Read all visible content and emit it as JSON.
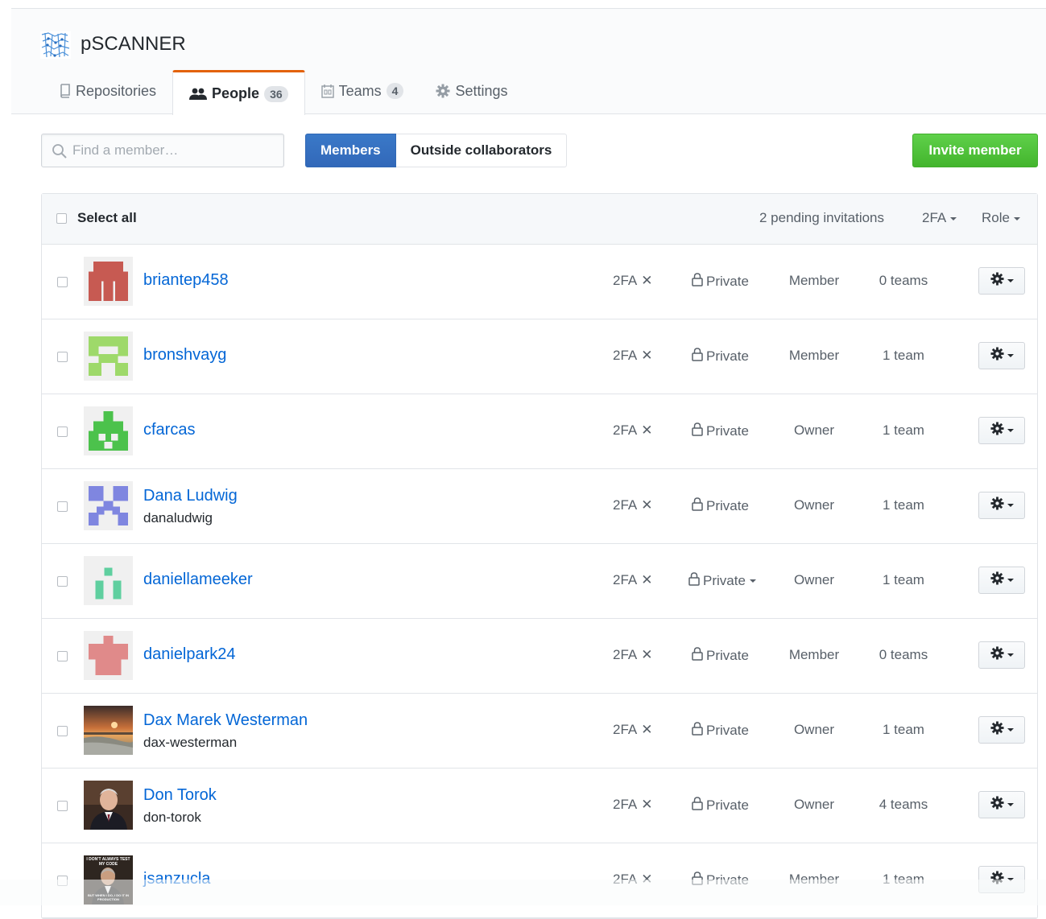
{
  "org": {
    "name": "pSCANNER"
  },
  "tabs": [
    {
      "label": "Repositories",
      "count": ""
    },
    {
      "label": "People",
      "count": "36"
    },
    {
      "label": "Teams",
      "count": "4"
    },
    {
      "label": "Settings",
      "count": ""
    }
  ],
  "search": {
    "placeholder": "Find a member…",
    "value": ""
  },
  "filter_toggle": {
    "members": "Members",
    "outside": "Outside collaborators"
  },
  "invite_label": "Invite member",
  "table_header": {
    "select_all": "Select all",
    "pending": "2 pending invitations",
    "tfa_filter": "2FA",
    "role_filter": "Role"
  },
  "members": [
    {
      "name": "briantep458",
      "login": "",
      "tfa": "2FA",
      "visibility": "Private",
      "role": "Member",
      "teams": "0 teams"
    },
    {
      "name": "bronshvayg",
      "login": "",
      "tfa": "2FA",
      "visibility": "Private",
      "role": "Member",
      "teams": "1 team"
    },
    {
      "name": "cfarcas",
      "login": "",
      "tfa": "2FA",
      "visibility": "Private",
      "role": "Owner",
      "teams": "1 team"
    },
    {
      "name": "Dana Ludwig",
      "login": "danaludwig",
      "tfa": "2FA",
      "visibility": "Private",
      "role": "Owner",
      "teams": "1 team"
    },
    {
      "name": "daniellameeker",
      "login": "",
      "tfa": "2FA",
      "visibility": "Private",
      "role": "Owner",
      "teams": "1 team"
    },
    {
      "name": "danielpark24",
      "login": "",
      "tfa": "2FA",
      "visibility": "Private",
      "role": "Member",
      "teams": "0 teams"
    },
    {
      "name": "Dax Marek Westerman",
      "login": "dax-westerman",
      "tfa": "2FA",
      "visibility": "Private",
      "role": "Owner",
      "teams": "1 team"
    },
    {
      "name": "Don Torok",
      "login": "don-torok",
      "tfa": "2FA",
      "visibility": "Private",
      "role": "Owner",
      "teams": "4 teams"
    },
    {
      "name": "jsanzucla",
      "login": "",
      "tfa": "2FA",
      "visibility": "Private",
      "role": "Member",
      "teams": "1 team"
    }
  ],
  "meme_text": {
    "top": "I DON'T ALWAYS TEST MY CODE",
    "bottom": "BUT WHEN I DO, I DO IT IN PRODUCTION"
  },
  "colors": {
    "link": "#0366d6",
    "selected_tab_accent": "#e36209",
    "invite_green": "#43b52d",
    "members_blue": "#3268b9"
  }
}
